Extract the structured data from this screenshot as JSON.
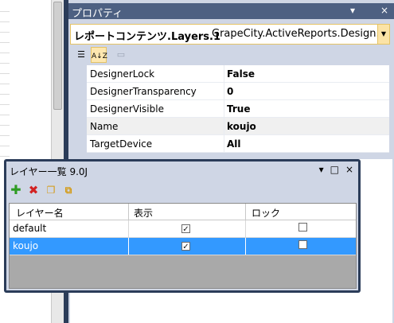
{
  "properties_panel": {
    "title": "プロパティ",
    "title_buttons": [
      "▾",
      "ᅟ",
      "×"
    ],
    "object_combo": {
      "name": "レポートコンテンツ.Layers.1",
      "type": "GrapeCity.ActiveReports.Design.Ddr"
    },
    "toolbar": {
      "categorized_icon": "categorized-icon",
      "alphabetical_icon": "alphabetical-icon",
      "property_pages_icon": "property-pages-icon",
      "alphabetical_label": "A↓Z"
    },
    "rows": [
      {
        "name": "DesignerLock",
        "value": "False"
      },
      {
        "name": "DesignerTransparency",
        "value": "0"
      },
      {
        "name": "DesignerVisible",
        "value": "True"
      },
      {
        "name": "Name",
        "value": "koujo"
      },
      {
        "name": "TargetDevice",
        "value": "All"
      }
    ]
  },
  "layer_window": {
    "title": "レイヤー一覧 9.0J",
    "title_buttons": [
      "▾",
      "□",
      "×"
    ],
    "toolbar": {
      "add_icon": "add-layer-icon",
      "delete_icon": "delete-layer-icon",
      "copy_icon": "copy-layer-icon",
      "move_icon": "move-layer-icon"
    },
    "columns": [
      "レイヤー名",
      "表示",
      "ロック"
    ],
    "rows": [
      {
        "name": "default",
        "visible": true,
        "locked": false,
        "selected": false
      },
      {
        "name": "koujo",
        "visible": true,
        "locked": false,
        "selected": true
      }
    ]
  },
  "colors": {
    "title_bar": "#4d6082",
    "window_frame": "#2b3c59",
    "panel_bg": "#cfd6e5",
    "selection": "#3399ff",
    "combo_border": "#e5c365"
  }
}
